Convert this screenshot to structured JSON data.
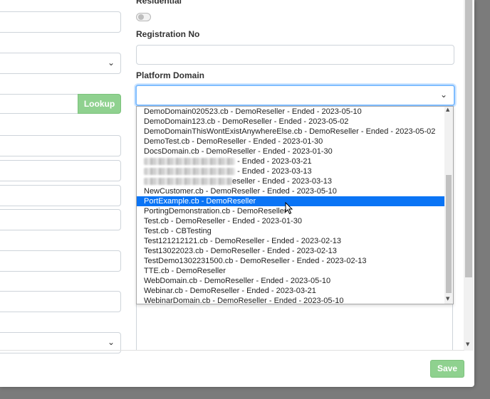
{
  "form": {
    "residential_label": "Residential",
    "registration_label": "Registration No",
    "registration_value": "",
    "platform_domain_label": "Platform Domain",
    "platform_domain_value": "",
    "lookup_label": "Lookup",
    "save_label": "Save"
  },
  "dropdown": {
    "selected_index": 9,
    "options": [
      "DemoDomain020523.cb - DemoReseller - Ended - 2023-05-10",
      "DemoDomain123.cb - DemoReseller - Ended - 2023-05-02",
      "DemoDomainThisWontExistAnywhereElse.cb - DemoReseller - Ended - 2023-05-02",
      "DemoTest.cb - DemoReseller - Ended - 2023-01-30",
      "DocsDomain.cb - DemoReseller - Ended - 2023-01-30",
      "- Ended - 2023-03-21",
      "- Ended - 2023-03-13",
      "eseller - Ended - 2023-03-13",
      "NewCustomer.cb - DemoReseller - Ended - 2023-05-10",
      "PortExample.cb - DemoReseller",
      "PortingDemonstration.cb - DemoReseller",
      "Test.cb - DemoReseller - Ended - 2023-01-30",
      "Test.cb - CBTesting",
      "Test121212121.cb - DemoReseller - Ended - 2023-02-13",
      "Test13022023.cb - DemoReseller - Ended - 2023-02-13",
      "TestDemo1302231500.cb - DemoReseller - Ended - 2023-02-13",
      "TTE.cb - DemoReseller",
      "WebDomain.cb - DemoReseller - Ended - 2023-05-10",
      "Webinar.cb - DemoReseller - Ended - 2023-03-21",
      "WebinarDomain.cb - DemoReseller - Ended - 2023-05-10"
    ]
  },
  "colors": {
    "accent_green": "#8fd18f",
    "selection_blue": "#0a74f5",
    "focus_border": "#80bdff"
  },
  "icons": {
    "select_chevron": "chevron-down-icon",
    "cursor": "mouse-pointer-icon"
  }
}
